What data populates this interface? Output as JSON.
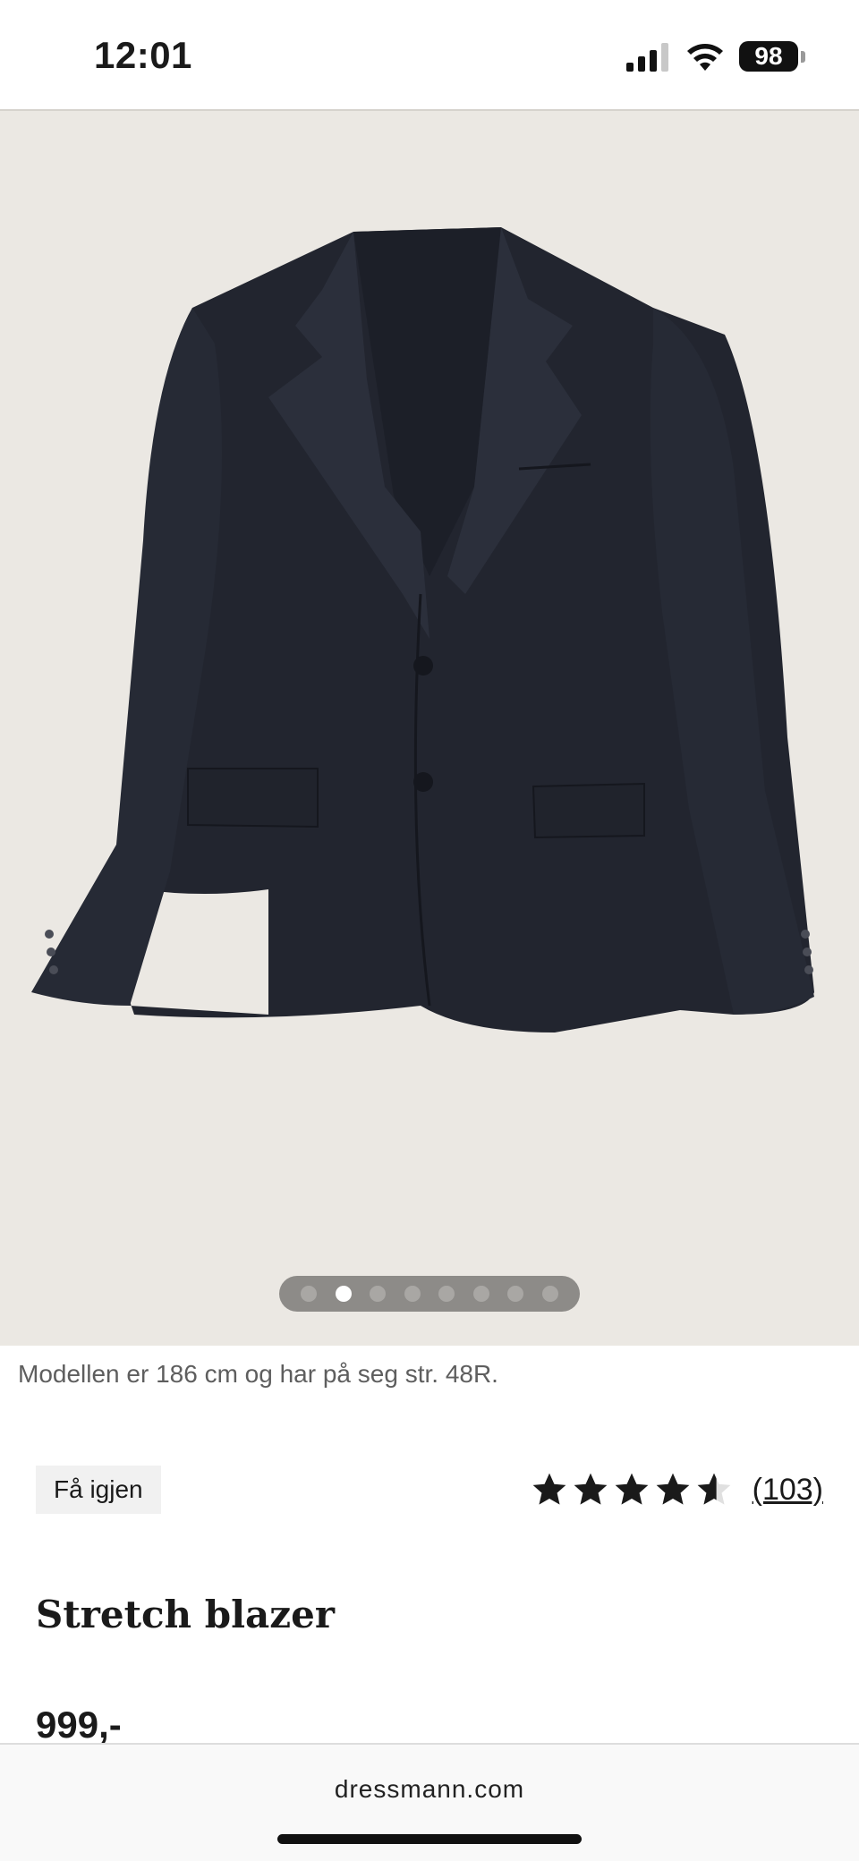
{
  "status_bar": {
    "time": "12:01",
    "battery_level": "98",
    "icons": [
      "signal-icon",
      "wifi-icon",
      "battery-icon"
    ]
  },
  "gallery": {
    "image_alt": "blazer-product-image",
    "dots_total": 8,
    "active_index": 1
  },
  "product": {
    "model_info": "Modellen er 186 cm og har på seg str. 48R.",
    "reminder_label": "Få igjen",
    "rating_value": 4.5,
    "review_count": "(103)",
    "title": "Stretch blazer",
    "price": "999,-"
  },
  "browser": {
    "url": "dressmann.com"
  },
  "colors": {
    "image_background": "#ebe8e3",
    "blazer": "#22252f",
    "accent_text": "#1a1a1a"
  }
}
